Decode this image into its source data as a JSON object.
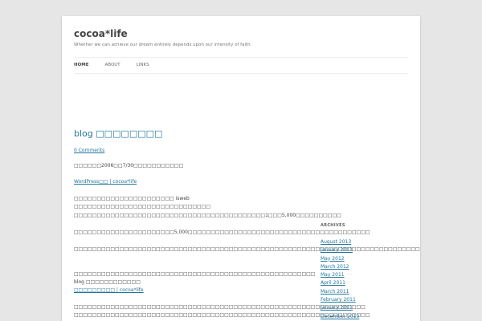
{
  "header": {
    "title": "cocoa*life",
    "description": "Whether we can achieve our dream entirely depends upon our intensity of faith."
  },
  "nav": {
    "items": [
      {
        "label": "HOME",
        "current": true
      },
      {
        "label": "ABOUT",
        "current": false
      },
      {
        "label": "LINKS",
        "current": false
      }
    ]
  },
  "post": {
    "title": "blog □□□□□□□□",
    "comments": "0 Comments",
    "paragraphs": [
      "□□□□□□2006□□7/30□□□□□□□□□□□",
      "WordPress□□ | cocoa*life",
      "□□□□□□□□□□□□□□□□□□□□□□ isweb □□□□□□□□□□□□□□□□□□□□□□□□□□□□□□",
      "□□□□□□□□□□□□□□□□□□□□□□□□□□□□□□□□□□□□□□□□□□1□□□5,000□□□□□□□□□□",
      "□□□□□□□□□□□□□□□□□□□□□□5,000□□□□□□□□□□□□□□□□□□□□□□□□□□□□□□□□□□□□□□□□",
      "□□□□□□□□□□□□□□□□□□□□□□□□□□□□□□□□□□□□□□□□□□□□□□□□□□□□□□□□□□□□□□□□□□□□□□□□□□□□□□□□□□□",
      "□□□□□□□□□□□□□□□□□□□□□□□□□□□□□□□□□□□□□□□□□□□□□□□□□□□□□ blog □□□□□□□□□□□□",
      "□□□□□□□□□ | cocoa*life",
      "□□□□□□□□□□□□□□□□□□□□□□□□□□□□□□□□□□□□□□□□□□□□□□□□□□□□□□□□□□□□□□□□ □□□□□□□□□□□□□□□□□□□□□□□□□□□□□□□□□□□□□□□□□□□□□□□□□□□□□□□□□□□□□□□□□"
    ]
  },
  "sidebar": {
    "heading": "ARCHIVES",
    "archives": [
      "August 2013",
      "January 2013",
      "May 2012",
      "March 2012",
      "May 2011",
      "April 2011",
      "March 2011",
      "February 2011",
      "January 2011",
      "December 2010"
    ]
  }
}
